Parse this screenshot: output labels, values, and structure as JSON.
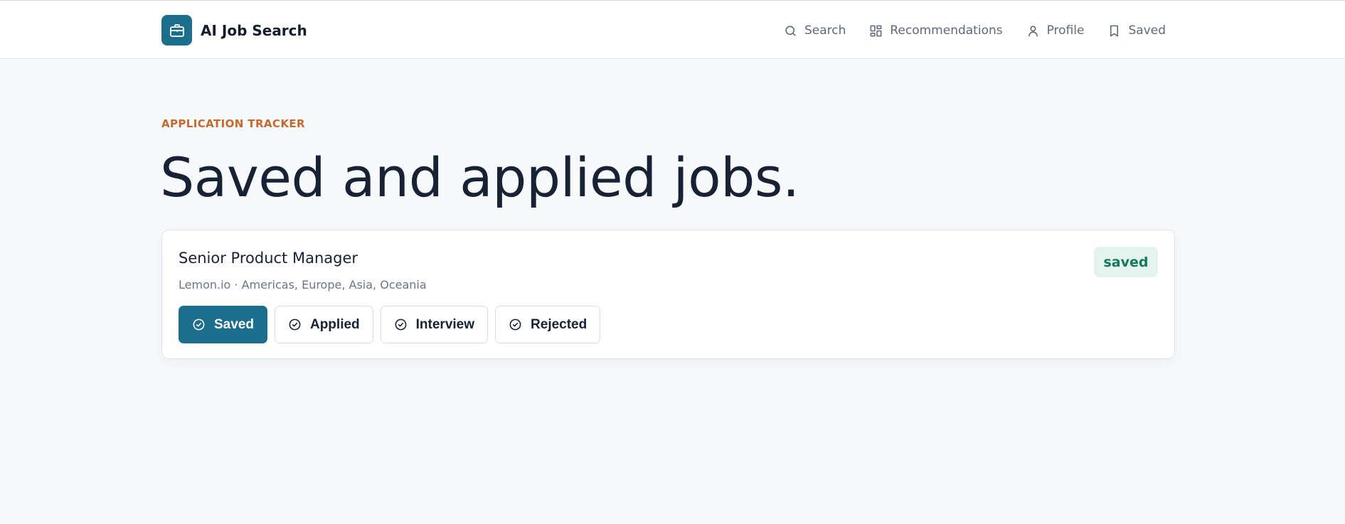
{
  "colors": {
    "brand": "#1c6e8c",
    "eyebrow": "#c8672c",
    "badge_bg": "#e4f3ee",
    "badge_text": "#15785a"
  },
  "header": {
    "logo_icon": "briefcase-icon",
    "app_name": "AI Job Search",
    "nav": [
      {
        "label": "Search",
        "icon": "search-icon"
      },
      {
        "label": "Recommendations",
        "icon": "grid-icon"
      },
      {
        "label": "Profile",
        "icon": "user-icon"
      },
      {
        "label": "Saved",
        "icon": "bookmark-icon"
      }
    ]
  },
  "main": {
    "eyebrow": "APPLICATION TRACKER",
    "title": "Saved and applied jobs."
  },
  "job": {
    "title": "Senior Product Manager",
    "meta": "Lemon.io · Americas, Europe, Asia, Oceania",
    "status_badge": "saved",
    "status_buttons": [
      {
        "label": "Saved",
        "icon": "check-circle-icon",
        "active": true
      },
      {
        "label": "Applied",
        "icon": "check-circle-icon",
        "active": false
      },
      {
        "label": "Interview",
        "icon": "check-circle-icon",
        "active": false
      },
      {
        "label": "Rejected",
        "icon": "check-circle-icon",
        "active": false
      }
    ]
  }
}
